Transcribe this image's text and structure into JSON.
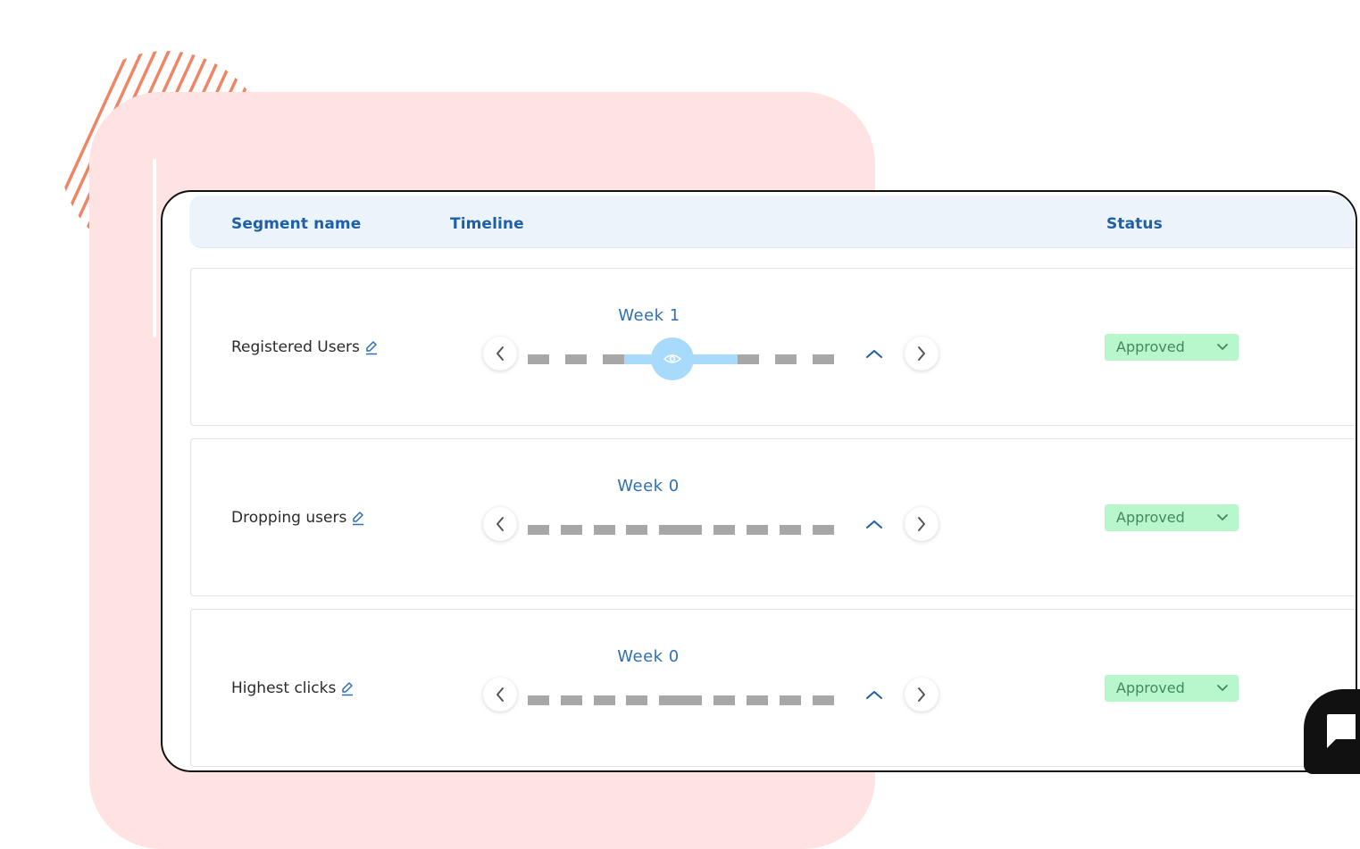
{
  "decor": {
    "hatch_color": "#f08566",
    "card_color": "#ffe3e2"
  },
  "table": {
    "headers": {
      "segment_name": "Segment name",
      "timeline": "Timeline",
      "status": "Status"
    },
    "rows": [
      {
        "segment_name": "Registered Users",
        "week": "Week 1",
        "status": "Approved",
        "active_period": true
      },
      {
        "segment_name": "Dropping users",
        "week": "Week 0",
        "status": "Approved",
        "active_period": false
      },
      {
        "segment_name": "Highest clicks",
        "week": "Week 0",
        "status": "Approved",
        "active_period": false
      }
    ]
  },
  "icons": {
    "edit": "pencil-icon",
    "prev": "chevron-left-icon",
    "next": "chevron-right-icon",
    "expand": "chevron-up-icon",
    "view": "eye-icon",
    "dropdown": "chevron-down-icon",
    "chat": "chat-bubble-icon"
  },
  "colors": {
    "header_text": "#1d5fa8",
    "week_text": "#2e6fb8",
    "status_bg": "#b8f7cc",
    "status_text": "#3f8a5d",
    "timeline_active": "#a8dbfb",
    "timeline_inactive": "#a7a7a7"
  }
}
